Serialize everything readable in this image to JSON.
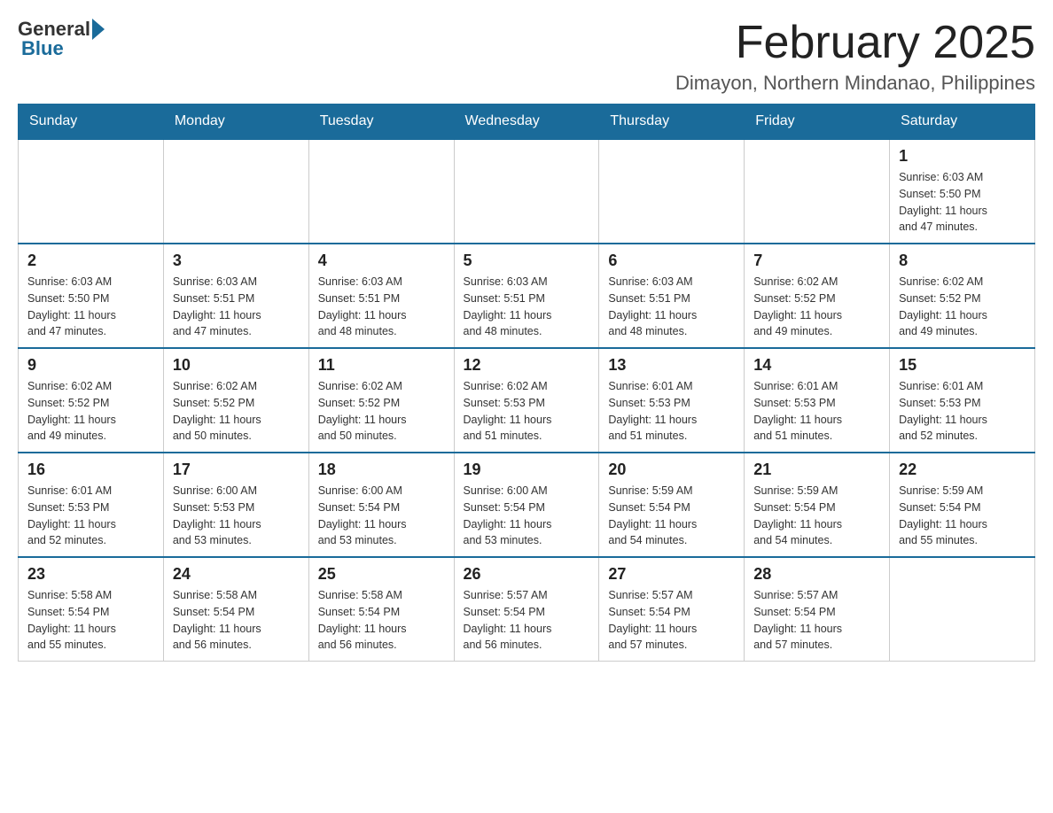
{
  "header": {
    "logo_general": "General",
    "logo_blue": "Blue",
    "title": "February 2025",
    "subtitle": "Dimayon, Northern Mindanao, Philippines"
  },
  "days_of_week": [
    "Sunday",
    "Monday",
    "Tuesday",
    "Wednesday",
    "Thursday",
    "Friday",
    "Saturday"
  ],
  "weeks": [
    [
      {
        "day": "",
        "info": ""
      },
      {
        "day": "",
        "info": ""
      },
      {
        "day": "",
        "info": ""
      },
      {
        "day": "",
        "info": ""
      },
      {
        "day": "",
        "info": ""
      },
      {
        "day": "",
        "info": ""
      },
      {
        "day": "1",
        "info": "Sunrise: 6:03 AM\nSunset: 5:50 PM\nDaylight: 11 hours\nand 47 minutes."
      }
    ],
    [
      {
        "day": "2",
        "info": "Sunrise: 6:03 AM\nSunset: 5:50 PM\nDaylight: 11 hours\nand 47 minutes."
      },
      {
        "day": "3",
        "info": "Sunrise: 6:03 AM\nSunset: 5:51 PM\nDaylight: 11 hours\nand 47 minutes."
      },
      {
        "day": "4",
        "info": "Sunrise: 6:03 AM\nSunset: 5:51 PM\nDaylight: 11 hours\nand 48 minutes."
      },
      {
        "day": "5",
        "info": "Sunrise: 6:03 AM\nSunset: 5:51 PM\nDaylight: 11 hours\nand 48 minutes."
      },
      {
        "day": "6",
        "info": "Sunrise: 6:03 AM\nSunset: 5:51 PM\nDaylight: 11 hours\nand 48 minutes."
      },
      {
        "day": "7",
        "info": "Sunrise: 6:02 AM\nSunset: 5:52 PM\nDaylight: 11 hours\nand 49 minutes."
      },
      {
        "day": "8",
        "info": "Sunrise: 6:02 AM\nSunset: 5:52 PM\nDaylight: 11 hours\nand 49 minutes."
      }
    ],
    [
      {
        "day": "9",
        "info": "Sunrise: 6:02 AM\nSunset: 5:52 PM\nDaylight: 11 hours\nand 49 minutes."
      },
      {
        "day": "10",
        "info": "Sunrise: 6:02 AM\nSunset: 5:52 PM\nDaylight: 11 hours\nand 50 minutes."
      },
      {
        "day": "11",
        "info": "Sunrise: 6:02 AM\nSunset: 5:52 PM\nDaylight: 11 hours\nand 50 minutes."
      },
      {
        "day": "12",
        "info": "Sunrise: 6:02 AM\nSunset: 5:53 PM\nDaylight: 11 hours\nand 51 minutes."
      },
      {
        "day": "13",
        "info": "Sunrise: 6:01 AM\nSunset: 5:53 PM\nDaylight: 11 hours\nand 51 minutes."
      },
      {
        "day": "14",
        "info": "Sunrise: 6:01 AM\nSunset: 5:53 PM\nDaylight: 11 hours\nand 51 minutes."
      },
      {
        "day": "15",
        "info": "Sunrise: 6:01 AM\nSunset: 5:53 PM\nDaylight: 11 hours\nand 52 minutes."
      }
    ],
    [
      {
        "day": "16",
        "info": "Sunrise: 6:01 AM\nSunset: 5:53 PM\nDaylight: 11 hours\nand 52 minutes."
      },
      {
        "day": "17",
        "info": "Sunrise: 6:00 AM\nSunset: 5:53 PM\nDaylight: 11 hours\nand 53 minutes."
      },
      {
        "day": "18",
        "info": "Sunrise: 6:00 AM\nSunset: 5:54 PM\nDaylight: 11 hours\nand 53 minutes."
      },
      {
        "day": "19",
        "info": "Sunrise: 6:00 AM\nSunset: 5:54 PM\nDaylight: 11 hours\nand 53 minutes."
      },
      {
        "day": "20",
        "info": "Sunrise: 5:59 AM\nSunset: 5:54 PM\nDaylight: 11 hours\nand 54 minutes."
      },
      {
        "day": "21",
        "info": "Sunrise: 5:59 AM\nSunset: 5:54 PM\nDaylight: 11 hours\nand 54 minutes."
      },
      {
        "day": "22",
        "info": "Sunrise: 5:59 AM\nSunset: 5:54 PM\nDaylight: 11 hours\nand 55 minutes."
      }
    ],
    [
      {
        "day": "23",
        "info": "Sunrise: 5:58 AM\nSunset: 5:54 PM\nDaylight: 11 hours\nand 55 minutes."
      },
      {
        "day": "24",
        "info": "Sunrise: 5:58 AM\nSunset: 5:54 PM\nDaylight: 11 hours\nand 56 minutes."
      },
      {
        "day": "25",
        "info": "Sunrise: 5:58 AM\nSunset: 5:54 PM\nDaylight: 11 hours\nand 56 minutes."
      },
      {
        "day": "26",
        "info": "Sunrise: 5:57 AM\nSunset: 5:54 PM\nDaylight: 11 hours\nand 56 minutes."
      },
      {
        "day": "27",
        "info": "Sunrise: 5:57 AM\nSunset: 5:54 PM\nDaylight: 11 hours\nand 57 minutes."
      },
      {
        "day": "28",
        "info": "Sunrise: 5:57 AM\nSunset: 5:54 PM\nDaylight: 11 hours\nand 57 minutes."
      },
      {
        "day": "",
        "info": ""
      }
    ]
  ]
}
